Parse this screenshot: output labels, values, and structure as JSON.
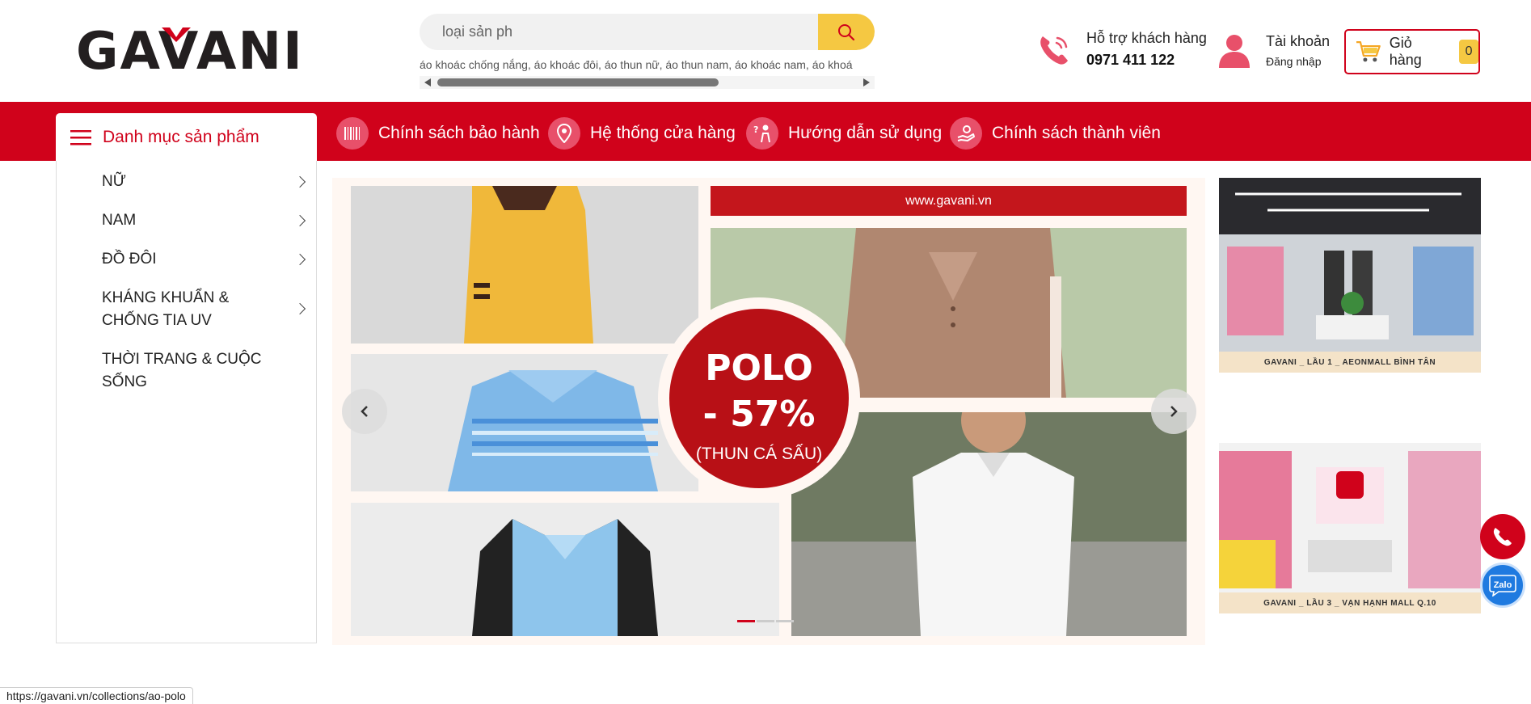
{
  "brand": {
    "logo_text": "GAVANI",
    "accent_color": "#d0021b",
    "yellow": "#f5c842"
  },
  "search": {
    "placeholder": "loại sản ph",
    "suggestions": "áo khoác chống nắng, áo khoác đôi, áo thun nữ, áo thun nam, áo khoác nam, áo khoá"
  },
  "support": {
    "label": "Hỗ trợ khách hàng",
    "phone": "0971 411 122",
    "icon": "phone-icon"
  },
  "account": {
    "label": "Tài khoản",
    "login": "Đăng nhập",
    "icon": "user-icon"
  },
  "cart": {
    "label": "Giỏ hàng",
    "count": "0",
    "icon": "cart-icon"
  },
  "nav": {
    "category_label": "Danh mục sản phẩm",
    "items": [
      {
        "label": "Chính sách bảo hành",
        "icon": "barcode-icon"
      },
      {
        "label": "Hệ thống cửa hàng",
        "icon": "location-pin-icon"
      },
      {
        "label": "Hướng dẫn sử dụng",
        "icon": "guide-person-icon"
      },
      {
        "label": "Chính sách thành viên",
        "icon": "member-hand-icon"
      }
    ]
  },
  "sidebar": {
    "items": [
      {
        "label": "NỮ",
        "has_children": true
      },
      {
        "label": "NAM",
        "has_children": true
      },
      {
        "label": "ĐỒ ĐÔI",
        "has_children": true
      },
      {
        "label": "KHÁNG KHUẨN & CHỐNG TIA UV",
        "has_children": true
      },
      {
        "label": "THỜI TRANG & CUỘC SỐNG",
        "has_children": false
      }
    ]
  },
  "banner": {
    "url_text": "www.gavani.vn",
    "promo_line1": "POLO",
    "promo_line2": "- 57%",
    "promo_line3": "(THUN CÁ SẤU)",
    "slide_count": 3,
    "active_slide": 1
  },
  "stores": [
    {
      "caption": "GAVANI _ LẦU 1 _ AEONMALL BÌNH TÂN"
    },
    {
      "caption": "GAVANI _ LẦU 3 _ VẠN HẠNH MALL Q.10"
    }
  ],
  "floating": {
    "zalo_label": "Zalo"
  },
  "status_bar": {
    "url": "https://gavani.vn/collections/ao-polo"
  }
}
